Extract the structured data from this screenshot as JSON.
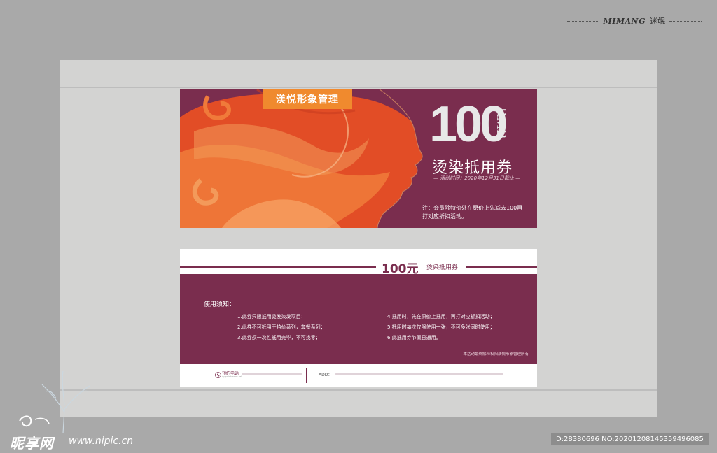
{
  "header": {
    "brand_en": "MIMANG",
    "brand_cn": "迷氓"
  },
  "front": {
    "brand": "渼悦形象管理",
    "amount": "100",
    "currency": "RMB",
    "title": "烫染抵用券",
    "period": "— 活动时间：2020年12月31日截止 —",
    "note": "注：会员除特价外在原价上先减去100再打对应折扣活动。"
  },
  "back": {
    "amount": "100元",
    "subtitle": "烫染抵用券",
    "notice_title": "使用须知：",
    "rules_left": [
      "1.此券只限抵用烫发染发项目；",
      "2.此券不可抵用于特价系列，套餐系列；",
      "3.此券须一次性抵用完毕，不可找零；"
    ],
    "rules_right": [
      "4.抵用时，先在原价上抵用，再打对应折扣活动；",
      "5.抵用时每次仅限使用一张，不可多张同时使用；",
      "6.此抵用券节假日通用。"
    ],
    "fine_print": "本活动最终解释权归渼悦形象管理所有",
    "phone_label": "预约电话",
    "phone_sub": "Appointment tel",
    "addr_label": "ADD："
  },
  "watermark": {
    "logo": "昵享网",
    "site": "www.nipic.cn"
  },
  "image_id": "ID:28380696 NO:20201208145359496085",
  "colors": {
    "plum": "#7a2d4e",
    "orange": "#f08a2e",
    "panel": "#d3d3d2"
  }
}
